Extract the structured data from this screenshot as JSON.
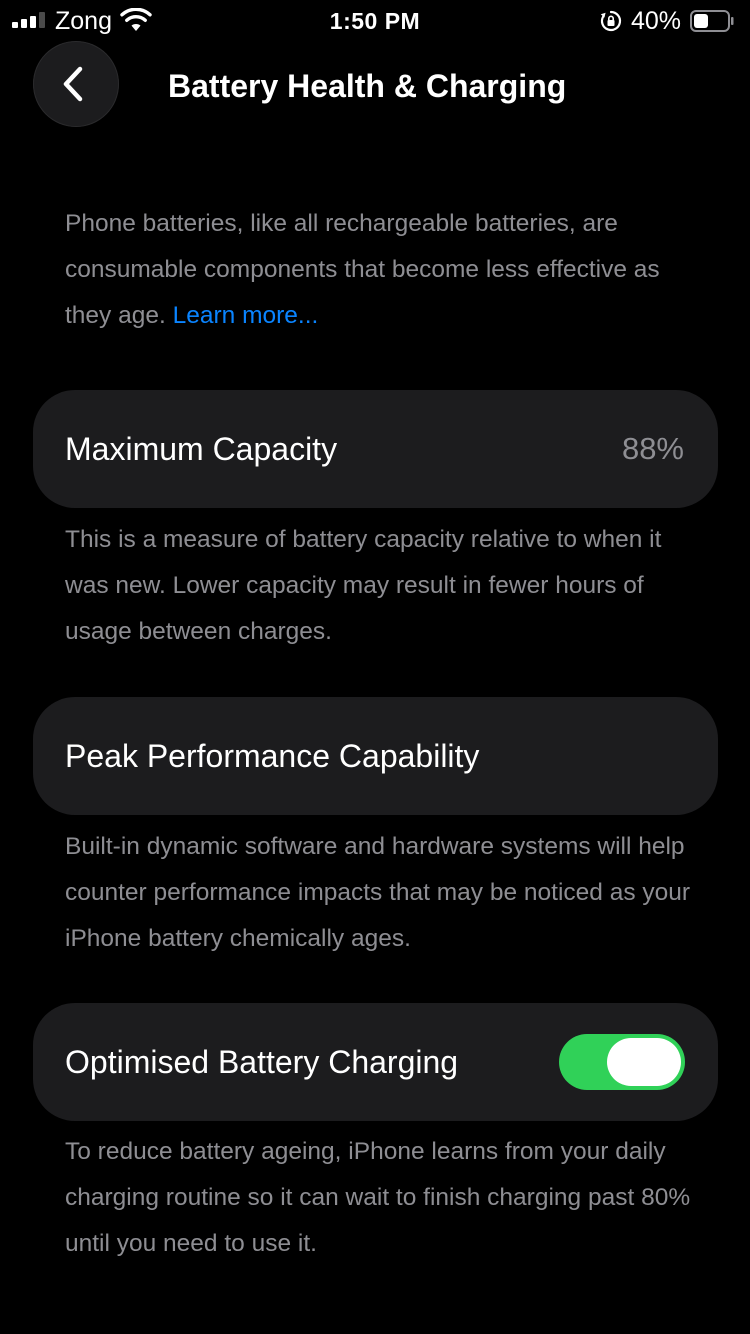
{
  "status_bar": {
    "carrier": "Zong",
    "time": "1:50 PM",
    "battery_percent": "40%",
    "battery_level": 0.4,
    "icons": [
      "signal-icon",
      "wifi-icon",
      "orientation-lock-icon",
      "battery-icon"
    ]
  },
  "nav": {
    "back_icon": "chevron-left-icon",
    "title": "Battery Health & Charging"
  },
  "intro": {
    "text": "Phone batteries, like all rechargeable batteries, are consumable components that become less effective as they age.",
    "link": "Learn more..."
  },
  "max_capacity": {
    "label": "Maximum Capacity",
    "value": "88%",
    "footer": "This is a measure of battery capacity relative to when it was new. Lower capacity may result in fewer hours of usage between charges."
  },
  "peak_performance": {
    "label": "Peak Performance Capability",
    "footer": "Built-in dynamic software and hardware systems will help counter performance impacts that may be noticed as your iPhone battery chemically ages."
  },
  "optimised_charging": {
    "label": "Optimised Battery Charging",
    "enabled": true,
    "footer": "To reduce battery ageing, iPhone learns from your daily charging routine so it can wait to finish charging past 80% until you need to use it."
  },
  "colors": {
    "background": "#000000",
    "cell": "#1c1c1e",
    "secondary_text": "#8e8e93",
    "link": "#0a84ff",
    "toggle_on": "#30d158"
  }
}
